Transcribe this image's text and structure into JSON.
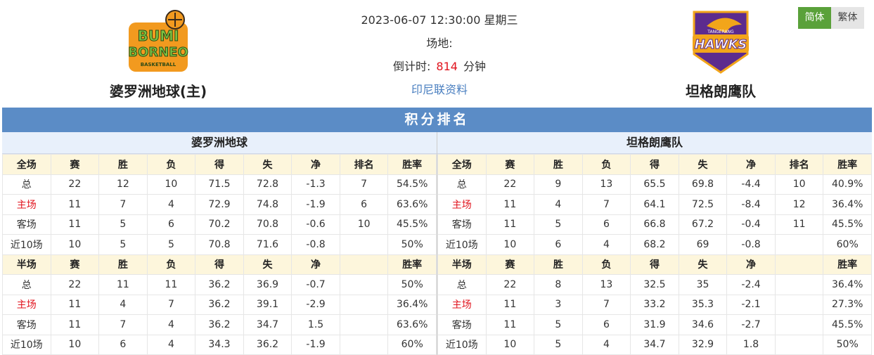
{
  "match": {
    "datetime": "2023-06-07 12:30:00 星期三",
    "venue": "场地:",
    "countdown_label": "倒计时:",
    "countdown_value": "814",
    "countdown_unit": "分钟",
    "league_link": "印尼联资料"
  },
  "home_team": {
    "name": "婆罗洲地球(主)",
    "logo_text_1": "BUMI",
    "logo_text_2": "BORNEO",
    "logo_text_3": "BASKETBALL"
  },
  "away_team": {
    "name": "坦格朗鹰队",
    "logo_text": "HAWKS",
    "logo_subtext": "TANGERANG"
  },
  "lang": {
    "simplified": "简体",
    "traditional": "繁体"
  },
  "standings": {
    "title": "积分排名",
    "left": {
      "team": "婆罗洲地球",
      "full_header": [
        "全场",
        "赛",
        "胜",
        "负",
        "得",
        "失",
        "净",
        "排名",
        "胜率"
      ],
      "full_rows": [
        [
          "总",
          "22",
          "12",
          "10",
          "71.5",
          "72.8",
          "-1.3",
          "7",
          "54.5%"
        ],
        [
          "主场",
          "11",
          "7",
          "4",
          "72.9",
          "74.8",
          "-1.9",
          "6",
          "63.6%"
        ],
        [
          "客场",
          "11",
          "5",
          "6",
          "70.2",
          "70.8",
          "-0.6",
          "10",
          "45.5%"
        ],
        [
          "近10场",
          "10",
          "5",
          "5",
          "70.8",
          "71.6",
          "-0.8",
          "",
          "50%"
        ]
      ],
      "half_header": [
        "半场",
        "赛",
        "胜",
        "负",
        "得",
        "失",
        "净",
        "",
        "胜率"
      ],
      "half_rows": [
        [
          "总",
          "22",
          "11",
          "11",
          "36.2",
          "36.9",
          "-0.7",
          "",
          "50%"
        ],
        [
          "主场",
          "11",
          "4",
          "7",
          "36.2",
          "39.1",
          "-2.9",
          "",
          "36.4%"
        ],
        [
          "客场",
          "11",
          "7",
          "4",
          "36.2",
          "34.7",
          "1.5",
          "",
          "63.6%"
        ],
        [
          "近10场",
          "10",
          "6",
          "4",
          "34.3",
          "36.2",
          "-1.9",
          "",
          "60%"
        ]
      ]
    },
    "right": {
      "team": "坦格朗鹰队",
      "full_header": [
        "全场",
        "赛",
        "胜",
        "负",
        "得",
        "失",
        "净",
        "排名",
        "胜率"
      ],
      "full_rows": [
        [
          "总",
          "22",
          "9",
          "13",
          "65.5",
          "69.8",
          "-4.4",
          "10",
          "40.9%"
        ],
        [
          "主场",
          "11",
          "4",
          "7",
          "64.1",
          "72.5",
          "-8.4",
          "12",
          "36.4%"
        ],
        [
          "客场",
          "11",
          "5",
          "6",
          "66.8",
          "67.2",
          "-0.4",
          "11",
          "45.5%"
        ],
        [
          "近10场",
          "10",
          "6",
          "4",
          "68.2",
          "69",
          "-0.8",
          "",
          "60%"
        ]
      ],
      "half_header": [
        "半场",
        "赛",
        "胜",
        "负",
        "得",
        "失",
        "净",
        "",
        "胜率"
      ],
      "half_rows": [
        [
          "总",
          "22",
          "8",
          "13",
          "32.5",
          "35",
          "-2.4",
          "",
          "36.4%"
        ],
        [
          "主场",
          "11",
          "3",
          "7",
          "33.2",
          "35.3",
          "-2.1",
          "",
          "27.3%"
        ],
        [
          "客场",
          "11",
          "5",
          "6",
          "31.9",
          "34.6",
          "-2.7",
          "",
          "45.5%"
        ],
        [
          "近10场",
          "10",
          "5",
          "4",
          "34.7",
          "32.9",
          "1.8",
          "",
          "50%"
        ]
      ]
    }
  },
  "colors": {
    "home_label": "#e1141e",
    "title_bar": "#5b8cc6",
    "header_row": "#fdf6dc",
    "active_lang": "#5aa13a"
  }
}
